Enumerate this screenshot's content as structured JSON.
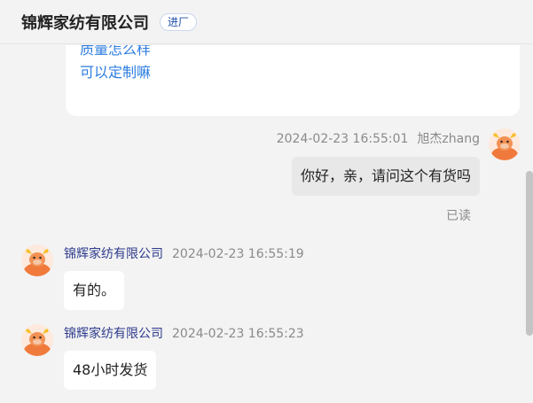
{
  "header": {
    "title": "锦辉家纺有限公司",
    "badge": "进厂"
  },
  "question_card": {
    "items": [
      "质量怎么样",
      "可以定制嘛"
    ]
  },
  "messages": [
    {
      "side": "right",
      "time": "2024-02-23 16:55:01",
      "sender": "旭杰zhang",
      "text": "你好，亲，请问这个有货吗",
      "status": "已读"
    },
    {
      "side": "left",
      "sender": "锦辉家纺有限公司",
      "time": "2024-02-23 16:55:19",
      "text": "有的。"
    },
    {
      "side": "left",
      "sender": "锦辉家纺有限公司",
      "time": "2024-02-23 16:55:23",
      "text": "48小时发货"
    }
  ],
  "colors": {
    "link": "#2d7de0",
    "sender": "#2d3a8c",
    "avatar": "#f07a3c"
  },
  "icons": {
    "avatar": "cartoon-bull-avatar-icon"
  }
}
